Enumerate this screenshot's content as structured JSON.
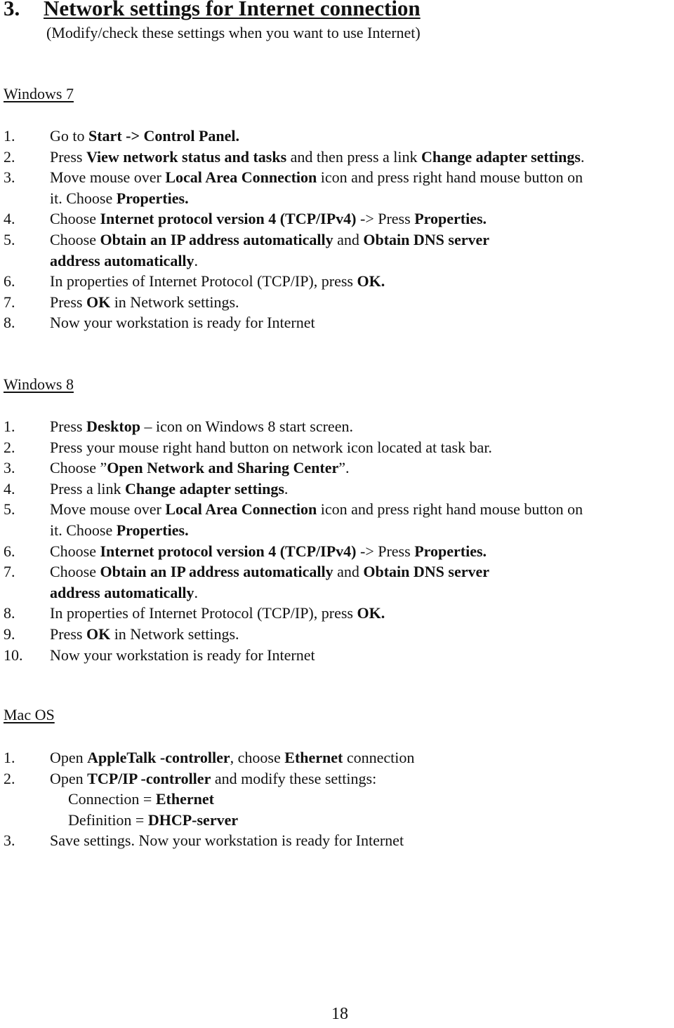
{
  "heading": {
    "number": "3.",
    "title": "Network settings for Internet connection"
  },
  "subtitle": "(Modify/check these settings when you want to use Internet)",
  "sections": {
    "win7": {
      "title": "Windows 7",
      "steps": [
        {
          "n": "1.",
          "lines": [
            [
              {
                "t": "Go to "
              },
              {
                "t": "Start -> Control Panel.",
                "b": true
              }
            ]
          ]
        },
        {
          "n": "2.",
          "lines": [
            [
              {
                "t": "Press "
              },
              {
                "t": "View network status and tasks",
                "b": true
              },
              {
                "t": " and then press a link "
              },
              {
                "t": "Change adapter settings",
                "b": true
              },
              {
                "t": "."
              }
            ]
          ]
        },
        {
          "n": "3.",
          "lines": [
            [
              {
                "t": "Move mouse over "
              },
              {
                "t": "Local Area Connection",
                "b": true
              },
              {
                "t": " icon and press right hand mouse button on"
              }
            ],
            [
              {
                "t": "it. Choose "
              },
              {
                "t": "Properties.",
                "b": true
              }
            ]
          ]
        },
        {
          "n": "4.",
          "lines": [
            [
              {
                "t": "Choose "
              },
              {
                "t": "Internet protocol version 4 (TCP/IPv4)",
                "b": true
              },
              {
                "t": " -> Press "
              },
              {
                "t": "Properties.",
                "b": true
              }
            ]
          ]
        },
        {
          "n": "5.",
          "lines": [
            [
              {
                "t": "Choose "
              },
              {
                "t": "Obtain an IP address automatically",
                "b": true
              },
              {
                "t": " and "
              },
              {
                "t": "Obtain DNS server",
                "b": true
              }
            ],
            [
              {
                "t": "address automatically",
                "b": true
              },
              {
                "t": "."
              }
            ]
          ]
        },
        {
          "n": "6.",
          "lines": [
            [
              {
                "t": "In properties of Internet Protocol (TCP/IP), press "
              },
              {
                "t": "OK.",
                "b": true
              }
            ]
          ]
        },
        {
          "n": "7.",
          "lines": [
            [
              {
                "t": "Press "
              },
              {
                "t": "OK",
                "b": true
              },
              {
                "t": " in Network settings."
              }
            ]
          ]
        },
        {
          "n": "8.",
          "lines": [
            [
              {
                "t": "Now your workstation is ready for Internet"
              }
            ]
          ]
        }
      ]
    },
    "win8": {
      "title": "Windows 8",
      "steps": [
        {
          "n": "1.",
          "lines": [
            [
              {
                "t": "Press "
              },
              {
                "t": "Desktop",
                "b": true
              },
              {
                "t": " – icon on Windows 8 start screen."
              }
            ]
          ]
        },
        {
          "n": "2.",
          "lines": [
            [
              {
                "t": "Press your mouse right hand button on network icon located at task bar."
              }
            ]
          ]
        },
        {
          "n": "3.",
          "lines": [
            [
              {
                "t": "Choose ”"
              },
              {
                "t": "Open Network and Sharing Center",
                "b": true
              },
              {
                "t": "”."
              }
            ]
          ]
        },
        {
          "n": "4.",
          "lines": [
            [
              {
                "t": "Press a link "
              },
              {
                "t": "Change adapter settings",
                "b": true
              },
              {
                "t": "."
              }
            ]
          ]
        },
        {
          "n": "5.",
          "lines": [
            [
              {
                "t": "Move mouse over "
              },
              {
                "t": "Local Area Connection",
                "b": true
              },
              {
                "t": " icon and press right hand mouse button on"
              }
            ],
            [
              {
                "t": "it. Choose "
              },
              {
                "t": "Properties.",
                "b": true
              }
            ]
          ]
        },
        {
          "n": "6.",
          "lines": [
            [
              {
                "t": "Choose "
              },
              {
                "t": "Internet protocol version 4 (TCP/IPv4)",
                "b": true
              },
              {
                "t": " -> Press "
              },
              {
                "t": "Properties.",
                "b": true
              }
            ]
          ]
        },
        {
          "n": "7.",
          "lines": [
            [
              {
                "t": "Choose "
              },
              {
                "t": "Obtain an IP address automatically",
                "b": true
              },
              {
                "t": " and "
              },
              {
                "t": "Obtain DNS server",
                "b": true
              }
            ],
            [
              {
                "t": "address automatically",
                "b": true
              },
              {
                "t": "."
              }
            ]
          ]
        },
        {
          "n": "8.",
          "lines": [
            [
              {
                "t": "In properties of Internet Protocol (TCP/IP), press "
              },
              {
                "t": "OK.",
                "b": true
              }
            ]
          ]
        },
        {
          "n": "9.",
          "lines": [
            [
              {
                "t": "Press "
              },
              {
                "t": "OK",
                "b": true
              },
              {
                "t": " in Network settings."
              }
            ]
          ]
        },
        {
          "n": "10.",
          "lines": [
            [
              {
                "t": "Now your workstation is ready for Internet"
              }
            ]
          ]
        }
      ]
    },
    "mac": {
      "title": "Mac OS",
      "steps": [
        {
          "n": "1.",
          "lines": [
            [
              {
                "t": "Open "
              },
              {
                "t": "AppleTalk -controller",
                "b": true
              },
              {
                "t": ", choose "
              },
              {
                "t": "Ethernet",
                "b": true
              },
              {
                "t": " connection"
              }
            ]
          ]
        },
        {
          "n": "2.",
          "lines": [
            [
              {
                "t": "Open "
              },
              {
                "t": "TCP/IP -controller",
                "b": true
              },
              {
                "t": " and modify these settings:"
              }
            ]
          ],
          "sublines": [
            [
              {
                "t": "Connection = "
              },
              {
                "t": "Ethernet",
                "b": true
              }
            ],
            [
              {
                "t": "Definition = "
              },
              {
                "t": "DHCP-server",
                "b": true
              }
            ]
          ]
        },
        {
          "n": "3.",
          "lines": [
            [
              {
                "t": "Save settings. Now your workstation is ready for Internet"
              }
            ]
          ]
        }
      ]
    }
  },
  "page_number": "18"
}
